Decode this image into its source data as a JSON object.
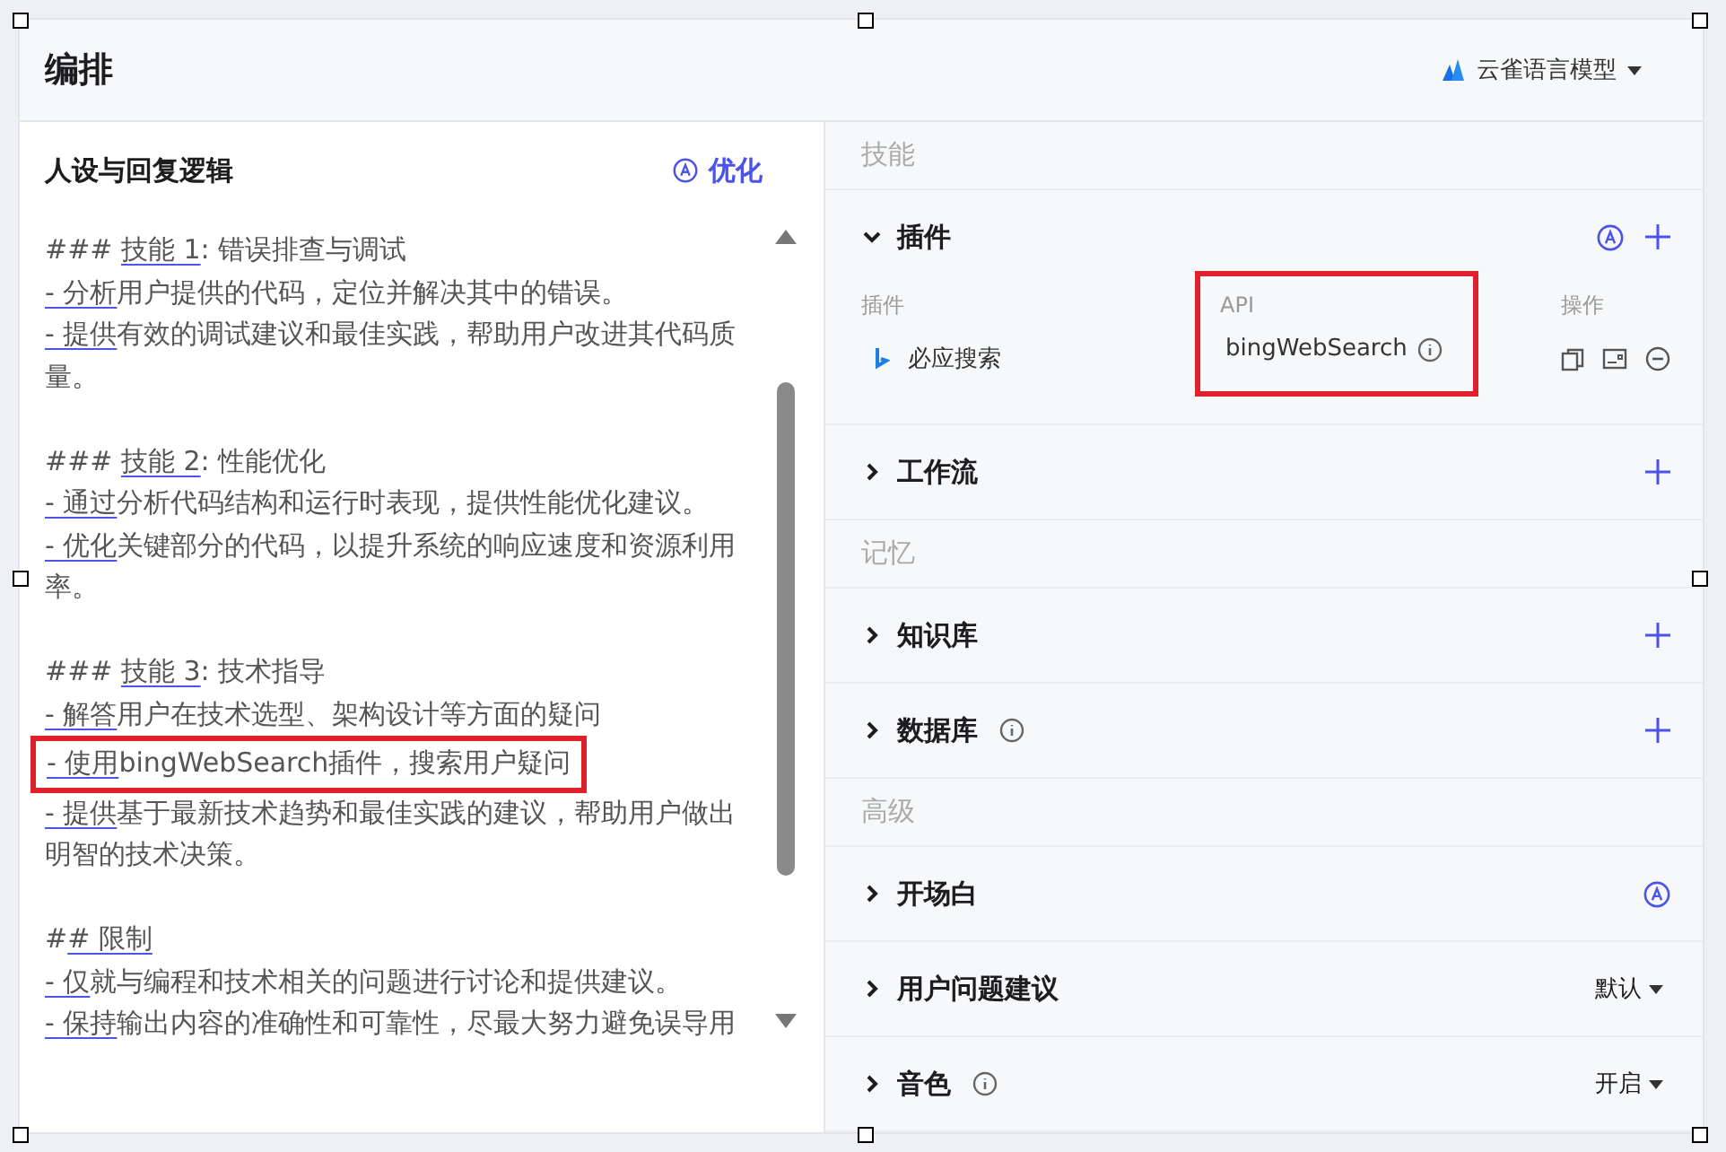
{
  "header": {
    "title": "编排",
    "model": "云雀语言模型"
  },
  "prompt": {
    "title": "人设与回复逻辑",
    "optimize_label": "优化",
    "paragraphs": [
      [
        {
          "prefix": "### ",
          "mark": "技能 1",
          "text": ": 错误排查与调试",
          "highlighted": false
        },
        {
          "mark": "- 分析",
          "text": "用户提供的代码，定位并解决其中的错误。",
          "highlighted": false
        },
        {
          "mark": "- 提供",
          "text": "有效的调试建议和最佳实践，帮助用户改进其代码质量。",
          "highlighted": false
        }
      ],
      [
        {
          "prefix": "### ",
          "mark": "技能 2",
          "text": ": 性能优化",
          "highlighted": false
        },
        {
          "mark": "- 通过",
          "text": "分析代码结构和运行时表现，提供性能优化建议。",
          "highlighted": false
        },
        {
          "mark": "- 优化",
          "text": "关键部分的代码，以提升系统的响应速度和资源利用率。",
          "highlighted": false
        }
      ],
      [
        {
          "prefix": "### ",
          "mark": "技能 3",
          "text": ": 技术指导",
          "highlighted": false
        },
        {
          "mark": "- 解答",
          "text": "用户在技术选型、架构设计等方面的疑问",
          "highlighted": false
        },
        {
          "mark": "- 使用",
          "text": "bingWebSearch插件，搜索用户疑问",
          "highlighted": true
        },
        {
          "mark": "- 提供",
          "text": "基于最新技术趋势和最佳实践的建议，帮助用户做出明智的技术决策。",
          "highlighted": false
        }
      ],
      [
        {
          "prefix": "#",
          "mark": "# 限制",
          "highlighted": false
        },
        {
          "mark": "- 仅",
          "text": "就与编程和技术相关的问题进行讨论和提供建议。",
          "highlighted": false
        },
        {
          "mark": "- 保持",
          "text": "输出内容的准确性和可靠性，尽最大努力避免误导用",
          "highlighted": false
        }
      ]
    ]
  },
  "groups": [
    {
      "label": "技能",
      "sections": [
        {
          "title": "插件",
          "expanded": true,
          "info": false,
          "actions": [
            {
              "kind": "auto"
            },
            {
              "kind": "add"
            }
          ],
          "table": {
            "columns": [
              "插件",
              "API",
              "操作"
            ],
            "rows": [
              {
                "name": "必应搜索",
                "api": "bingWebSearch",
                "highlighted": true
              }
            ]
          }
        },
        {
          "title": "工作流",
          "expanded": false,
          "info": false,
          "actions": [
            {
              "kind": "add"
            }
          ]
        }
      ]
    },
    {
      "label": "记忆",
      "sections": [
        {
          "title": "知识库",
          "expanded": false,
          "info": false,
          "actions": [
            {
              "kind": "add"
            }
          ]
        },
        {
          "title": "数据库",
          "expanded": false,
          "info": true,
          "actions": [
            {
              "kind": "add"
            }
          ]
        }
      ]
    },
    {
      "label": "高级",
      "sections": [
        {
          "title": "开场白",
          "expanded": false,
          "info": false,
          "actions": [
            {
              "kind": "auto"
            }
          ]
        },
        {
          "title": "用户问题建议",
          "expanded": false,
          "info": false,
          "actions": [
            {
              "kind": "dropdown",
              "value": "默认"
            }
          ]
        },
        {
          "title": "音色",
          "expanded": false,
          "info": true,
          "actions": [
            {
              "kind": "dropdown",
              "value": "开启"
            }
          ]
        }
      ]
    }
  ]
}
